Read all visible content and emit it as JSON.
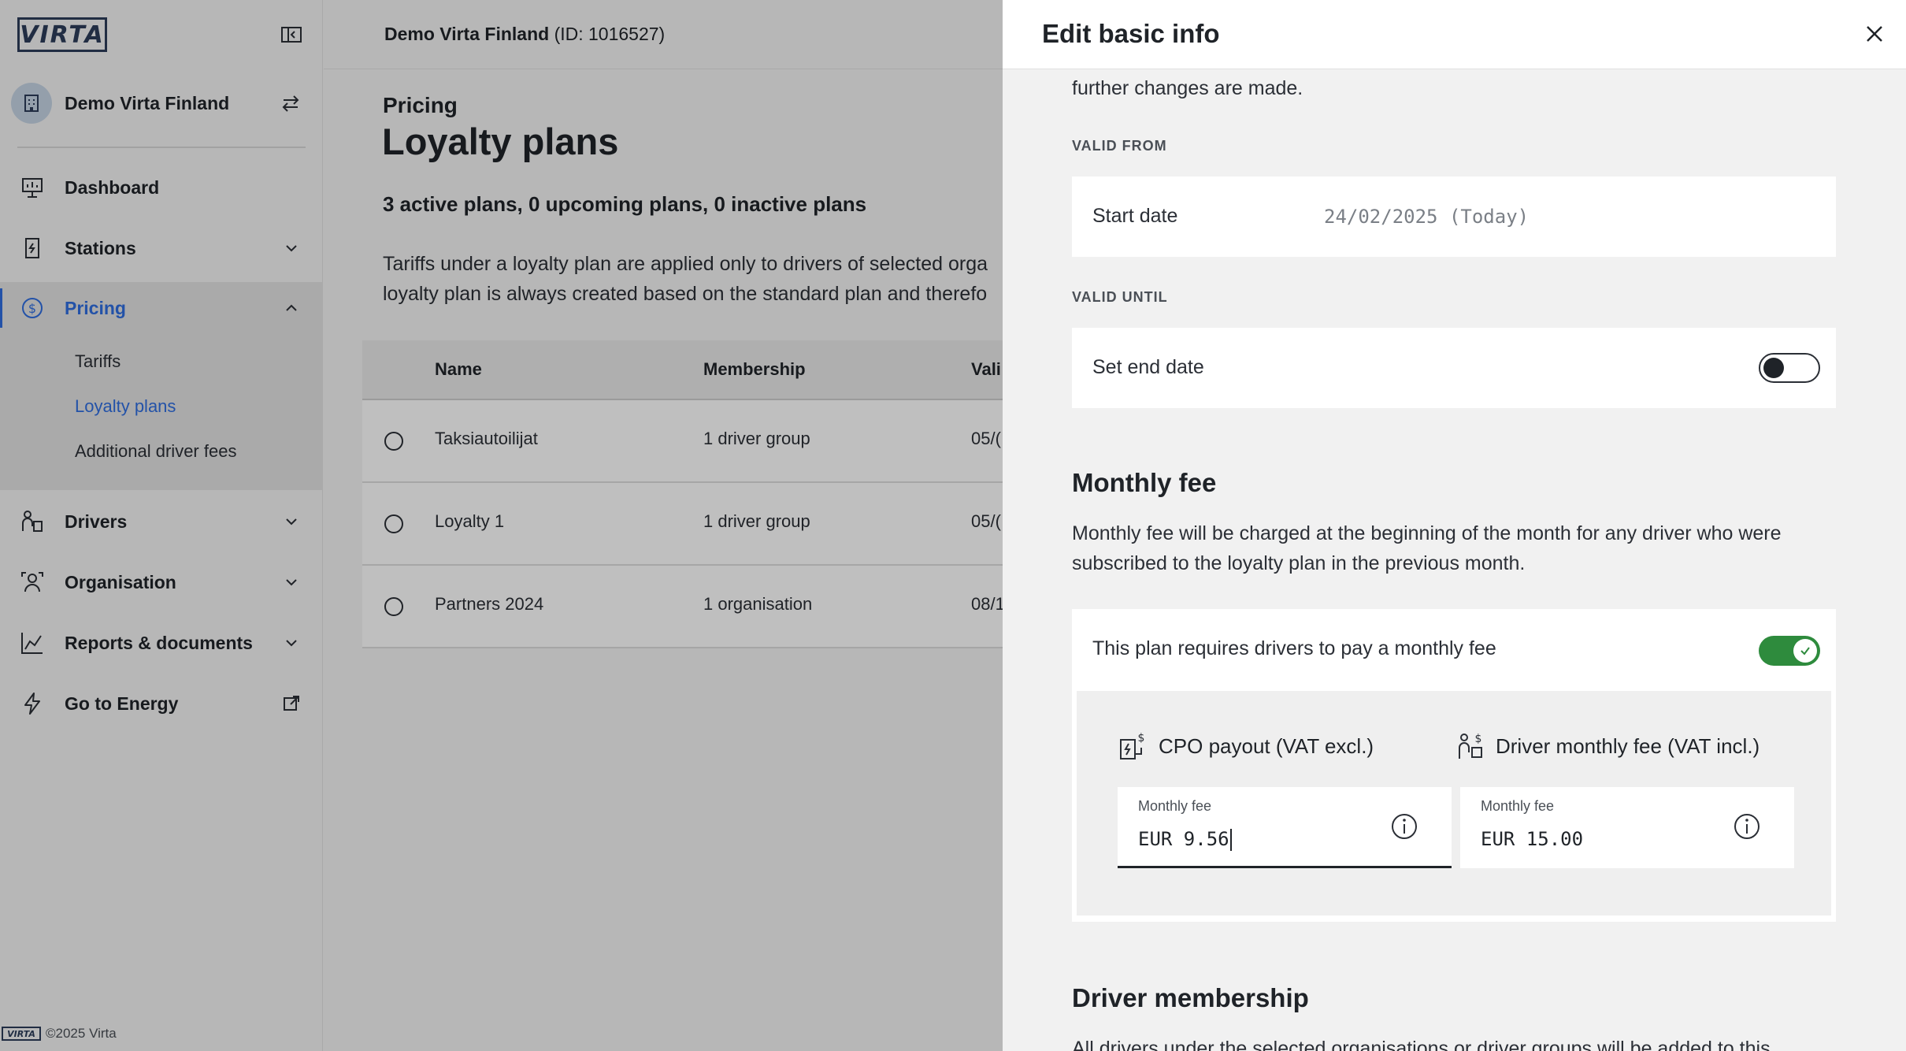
{
  "sidebar": {
    "logo_text": "VIRTA",
    "org_name": "Demo Virta Finland",
    "nav": {
      "dashboard": "Dashboard",
      "stations": "Stations",
      "pricing": "Pricing",
      "drivers": "Drivers",
      "organisation": "Organisation",
      "reports": "Reports & documents",
      "energy": "Go to Energy"
    },
    "pricing_sub": {
      "tariffs": "Tariffs",
      "loyalty": "Loyalty plans",
      "fees": "Additional driver fees"
    },
    "footer_logo": "VIRTA",
    "footer_copy": "©2025 Virta"
  },
  "topbar": {
    "org_name": "Demo Virta Finland",
    "org_id": "(ID: 1016527)"
  },
  "page": {
    "breadcrumb": "Pricing",
    "title": "Loyalty plans",
    "summary": "3 active plans, 0 upcoming plans, 0 inactive plans",
    "desc_line1": "Tariffs under a loyalty plan are applied only to drivers of selected orga",
    "desc_line2": "loyalty plan is always created based on the standard plan and therefo"
  },
  "table": {
    "headers": {
      "name": "Name",
      "membership": "Membership",
      "valid": "Vali"
    },
    "rows": [
      {
        "name": "Taksiautoilijat",
        "membership": "1 driver group",
        "valid": "05/("
      },
      {
        "name": "Loyalty 1",
        "membership": "1 driver group",
        "valid": "05/("
      },
      {
        "name": "Partners 2024",
        "membership": "1 organisation",
        "valid": "08/1"
      }
    ]
  },
  "drawer": {
    "title": "Edit basic info",
    "intro_tail": "further changes are made.",
    "valid_from_caption": "VALID FROM",
    "start_date_label": "Start date",
    "start_date_value": "24/02/2025 (Today)",
    "valid_until_caption": "VALID UNTIL",
    "end_date_label": "Set end date",
    "end_date_enabled": false,
    "monthly_fee_heading": "Monthly fee",
    "monthly_fee_desc_line1": "Monthly fee will be charged at the beginning of the month for any driver who were",
    "monthly_fee_desc_line2": "subscribed to the loyalty plan in the previous month.",
    "requires_fee_label": "This plan requires drivers to pay a monthly fee",
    "requires_fee_enabled": true,
    "cpo_heading": "CPO payout (VAT excl.)",
    "driver_heading": "Driver monthly fee (VAT incl.)",
    "cpo_field_label": "Monthly fee",
    "cpo_field_value": "EUR 9.56",
    "driver_field_label": "Monthly fee",
    "driver_field_value": "EUR 15.00",
    "membership_heading": "Driver membership",
    "membership_desc": "All drivers under the selected organisations or driver groups will be added to this"
  },
  "colors": {
    "accent": "#2f6ee0",
    "toggle_on": "#2e8b3d",
    "text": "#1f2328"
  }
}
